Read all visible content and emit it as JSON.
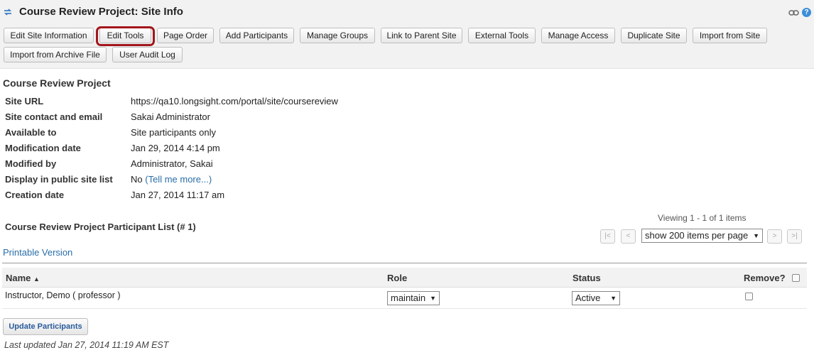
{
  "header": {
    "title": "Course Review Project: Site Info",
    "icons": [
      "refresh-icon",
      "link-icon",
      "help-icon"
    ],
    "help_glyph": "?"
  },
  "toolbar": {
    "buttons": [
      "Edit Site Information",
      "Edit Tools",
      "Page Order",
      "Add Participants",
      "Manage Groups",
      "Link to Parent Site",
      "External Tools",
      "Manage Access",
      "Duplicate Site",
      "Import from Site",
      "Import from Archive File",
      "User Audit Log"
    ],
    "highlighted": "Edit Tools",
    "highlight_color": "#a3161c"
  },
  "site": {
    "name": "Course Review Project",
    "info": [
      {
        "label": "Site URL",
        "value": "https://qa10.longsight.com/portal/site/coursereview"
      },
      {
        "label": "Site contact and email",
        "value": "Sakai Administrator"
      },
      {
        "label": "Available to",
        "value": "Site participants only"
      },
      {
        "label": "Modification date",
        "value": "Jan 29, 2014 4:14 pm"
      },
      {
        "label": "Modified by",
        "value": "Administrator, Sakai"
      },
      {
        "label": "Display in public site list",
        "value": "No",
        "link": "(Tell me more...)"
      },
      {
        "label": "Creation date",
        "value": "Jan 27, 2014 11:17 am"
      }
    ]
  },
  "participants": {
    "title": "Course Review Project Participant List (# 1)",
    "viewing": "Viewing 1 - 1 of 1 items",
    "pager": {
      "first": "|<",
      "prev": "<",
      "next": ">",
      "last": ">|"
    },
    "page_size": "show 200 items per page",
    "printable": "Printable Version",
    "columns": {
      "name": "Name",
      "sort_glyph": "▲",
      "role": "Role",
      "status": "Status",
      "remove": "Remove?"
    },
    "rows": [
      {
        "name": "Instructor, Demo ( professor )",
        "role": "maintain",
        "status": "Active"
      }
    ],
    "update_button": "Update Participants",
    "last_updated": "Last updated Jan 27, 2014 11:19 AM EST"
  },
  "colors": {
    "link": "#2a6ea8",
    "help": "#3b8ed8"
  }
}
